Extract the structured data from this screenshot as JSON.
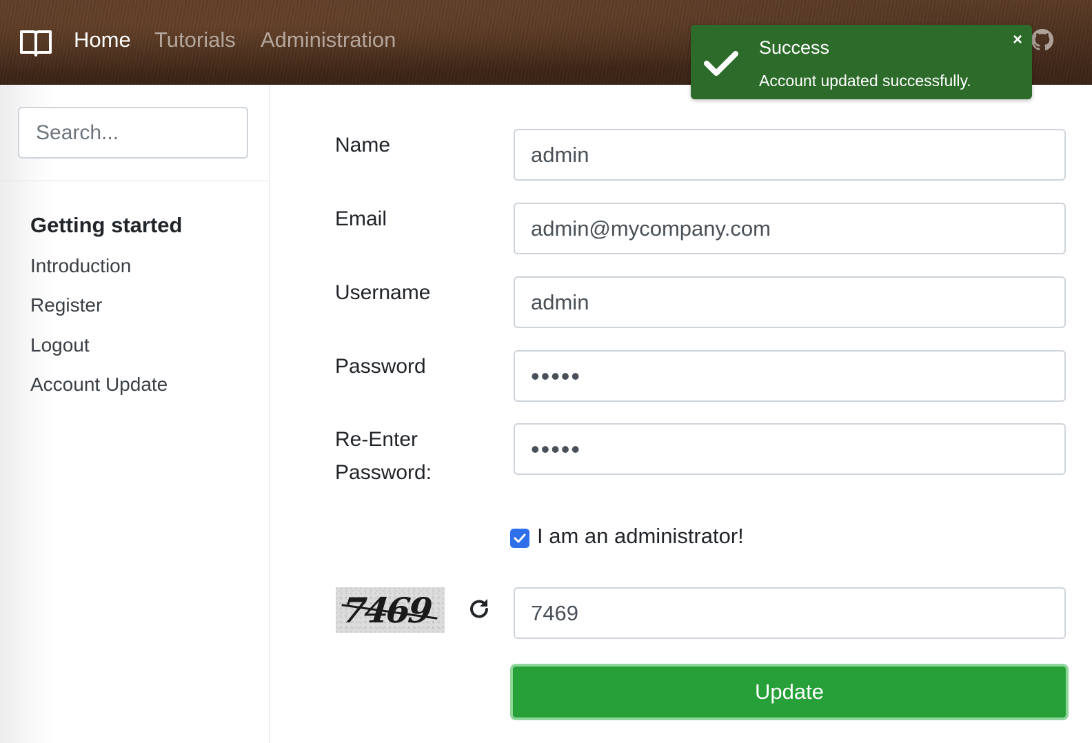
{
  "navbar": {
    "logo_icon": "book-open-icon",
    "links": [
      {
        "label": "Home",
        "active": true
      },
      {
        "label": "Tutorials",
        "active": false
      },
      {
        "label": "Administration",
        "active": false
      }
    ],
    "github_icon": "github-icon"
  },
  "toast": {
    "title": "Success",
    "message": "Account updated successfully.",
    "close_label": "×",
    "icon": "checkmark-icon",
    "color": "#2d6b2a"
  },
  "sidebar": {
    "search_placeholder": "Search...",
    "heading": "Getting started",
    "items": [
      {
        "label": "Introduction"
      },
      {
        "label": "Register"
      },
      {
        "label": "Logout"
      },
      {
        "label": "Account Update"
      }
    ]
  },
  "form": {
    "name": {
      "label": "Name",
      "value": "admin"
    },
    "email": {
      "label": "Email",
      "value": "admin@mycompany.com"
    },
    "username": {
      "label": "Username",
      "value": "admin"
    },
    "password": {
      "label": "Password",
      "value": "•••••"
    },
    "reenter": {
      "label_line1": "Re-Enter",
      "label_line2": "Password:",
      "value": "•••••"
    },
    "admin_checkbox": {
      "label": "I am an administrator!",
      "checked": true
    },
    "captcha": {
      "image_text": "7469",
      "value": "7469",
      "refresh_icon": "refresh-icon"
    },
    "submit_label": "Update"
  },
  "colors": {
    "accent_green": "#28a039",
    "checkbox_blue": "#2f6fea"
  }
}
